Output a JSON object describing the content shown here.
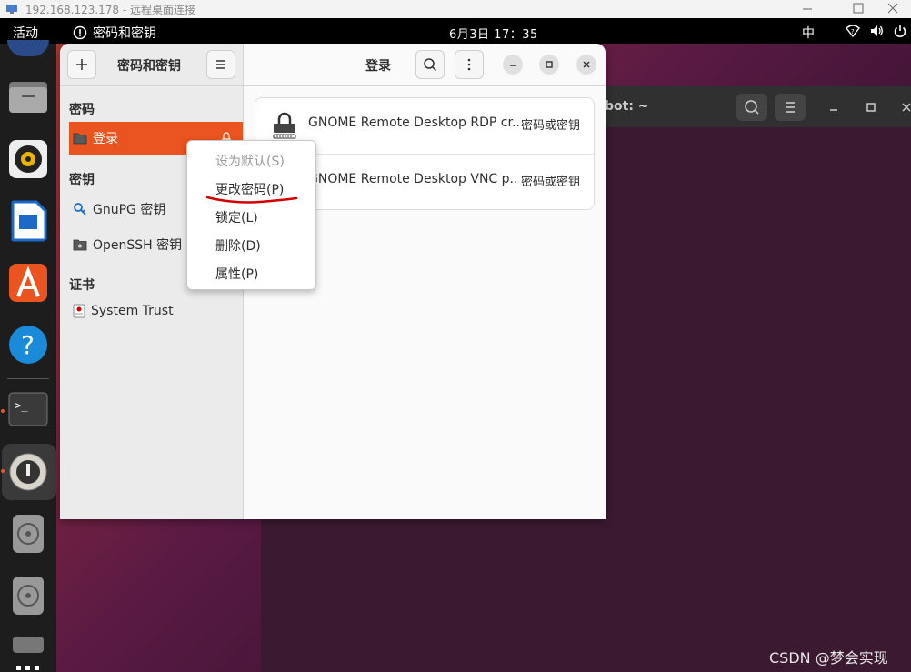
{
  "rdp": {
    "title": "192.168.123.178 - 远程桌面连接"
  },
  "topbar": {
    "activities": "活动",
    "app_name": "密码和密钥",
    "clock": "6月3日  17：35",
    "ime": "中"
  },
  "terminal": {
    "title": "bot: ~"
  },
  "window": {
    "sidebar_title": "密码和密钥",
    "main_title": "登录",
    "sections": {
      "passwords": "密码",
      "keys": "密钥",
      "certificates": "证书"
    },
    "sidebar_items": {
      "login": "登录",
      "gnupg": "GnuPG 密钥",
      "openssh": "OpenSSH 密钥",
      "system_trust": "System Trust"
    },
    "rows": [
      {
        "name": "GNOME Remote Desktop RDP cr...",
        "type": "密码或密钥"
      },
      {
        "name": "GNOME Remote Desktop VNC p...",
        "type": "密码或密钥"
      }
    ]
  },
  "context_menu": {
    "items": [
      {
        "label": "设为默认(S)",
        "enabled": false
      },
      {
        "label": "更改密码(P)",
        "enabled": true
      },
      {
        "label": "锁定(L)",
        "enabled": true
      },
      {
        "label": "删除(D)",
        "enabled": true
      },
      {
        "label": "属性(P)",
        "enabled": true
      }
    ]
  },
  "watermark": "CSDN @梦会实现",
  "colors": {
    "accent": "#e95420",
    "annotation": "#d40000"
  }
}
